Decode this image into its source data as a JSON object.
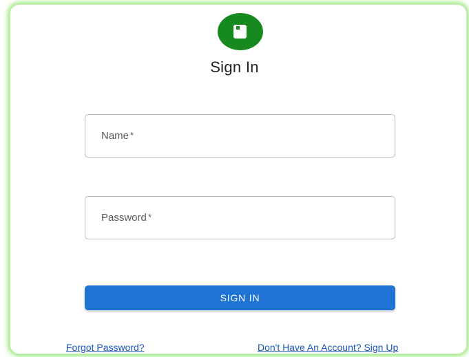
{
  "page": {
    "title": "Sign In"
  },
  "form": {
    "name_label": "Name",
    "password_label": "Password",
    "required_mark": "*",
    "submit_label": "SIGN IN"
  },
  "links": {
    "forgot_password": "Forgot Password?",
    "sign_up": "Don't Have An Account? Sign Up"
  },
  "icons": {
    "avatar": "book-icon"
  },
  "colors": {
    "avatar_bg": "#178a1f",
    "button_bg": "#1f74d3",
    "link": "#1a58b8",
    "card_glow": "#9be87f"
  }
}
